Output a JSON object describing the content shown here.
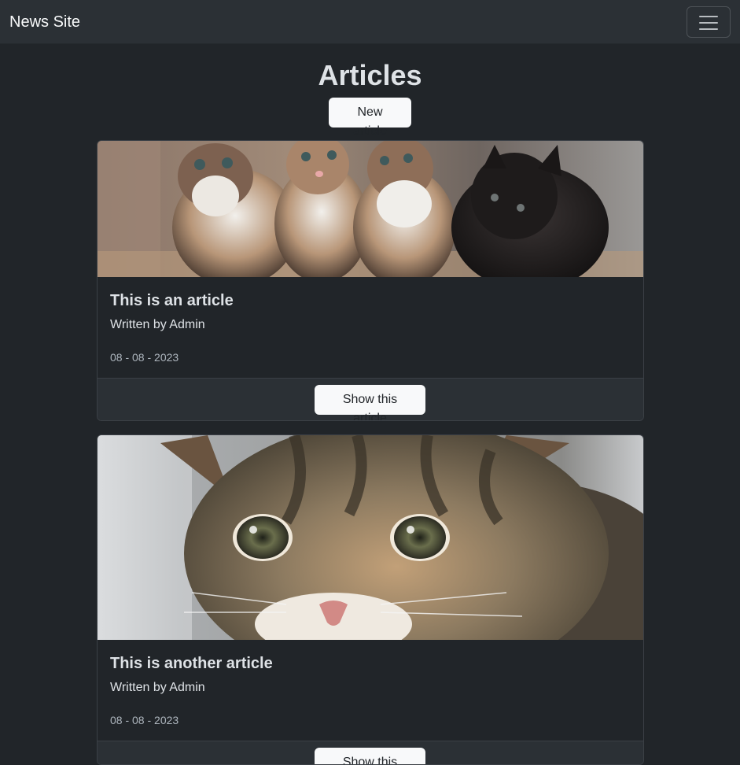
{
  "navbar": {
    "brand": "News Site",
    "toggler_icon": "hamburger-menu-icon"
  },
  "page": {
    "title": "Articles",
    "new_article_label": "New article"
  },
  "articles": [
    {
      "image": "kittens-photo",
      "title": "This is an article",
      "author": "Written by Admin",
      "date": "08 - 08 - 2023",
      "show_label": "Show this article"
    },
    {
      "image": "tabby-kitten-photo",
      "title": "This is another article",
      "author": "Written by Admin",
      "date": "08 - 08 - 2023",
      "show_label": "Show this article"
    }
  ],
  "colors": {
    "background": "#212529",
    "navbar": "#2b3035",
    "button": "#f8f9fa",
    "card_border": "#3b4046"
  }
}
